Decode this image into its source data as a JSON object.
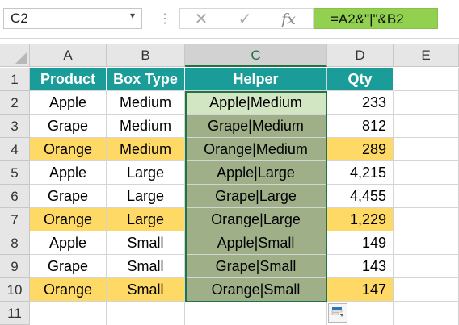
{
  "formula_bar": {
    "name_box": "C2",
    "name_box_arrow": "▾",
    "dots": "⋮",
    "cancel_icon": "✕",
    "enter_icon": "✓",
    "fx_label": "fx",
    "formula": "=A2&\"|\"&B2"
  },
  "columns": [
    "A",
    "B",
    "C",
    "D",
    "E"
  ],
  "rows": [
    "1",
    "2",
    "3",
    "4",
    "5",
    "6",
    "7",
    "8",
    "9",
    "10",
    "11"
  ],
  "headers": {
    "product": "Product",
    "box_type": "Box Type",
    "helper": "Helper",
    "qty": "Qty"
  },
  "data": [
    {
      "product": "Apple",
      "box": "Medium",
      "helper": "Apple|Medium",
      "qty": "233",
      "highlight": false
    },
    {
      "product": "Grape",
      "box": "Medium",
      "helper": "Grape|Medium",
      "qty": "812",
      "highlight": false
    },
    {
      "product": "Orange",
      "box": "Medium",
      "helper": "Orange|Medium",
      "qty": "289",
      "highlight": true
    },
    {
      "product": "Apple",
      "box": "Large",
      "helper": "Apple|Large",
      "qty": "4,215",
      "highlight": false
    },
    {
      "product": "Grape",
      "box": "Large",
      "helper": "Grape|Large",
      "qty": "4,455",
      "highlight": false
    },
    {
      "product": "Orange",
      "box": "Large",
      "helper": "Orange|Large",
      "qty": "1,229",
      "highlight": true
    },
    {
      "product": "Apple",
      "box": "Small",
      "helper": "Apple|Small",
      "qty": "149",
      "highlight": false
    },
    {
      "product": "Grape",
      "box": "Small",
      "helper": "Grape|Small",
      "qty": "143",
      "highlight": false
    },
    {
      "product": "Orange",
      "box": "Small",
      "helper": "Orange|Small",
      "qty": "147",
      "highlight": true
    }
  ],
  "colors": {
    "header_fill": "#1a9c99",
    "helper_fill": "#9fb089",
    "active_cell_fill": "#d2e6c4",
    "orange_row_fill": "#ffd966",
    "formula_fill": "#92d050",
    "selection_border": "#217346"
  },
  "icons": {
    "quick_analysis": "quick-analysis-icon"
  }
}
